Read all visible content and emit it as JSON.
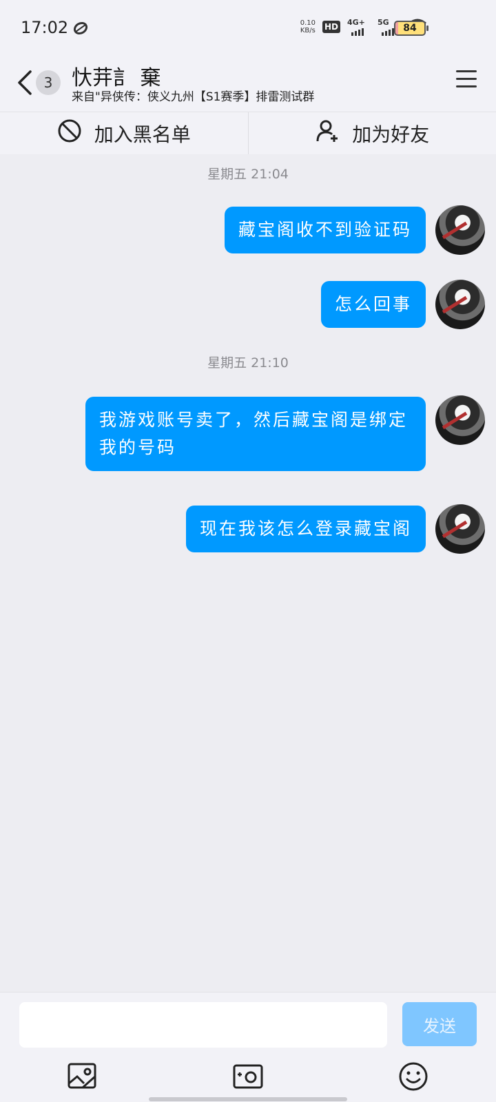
{
  "status_bar": {
    "time": "17:02",
    "net_speed_value": "0.10",
    "net_speed_unit": "KB/s",
    "hd_label": "HD",
    "net_4g": "4G+",
    "net_5g": "5G",
    "battery": "84"
  },
  "header": {
    "back_badge": "3",
    "title": "忕茾訁 棄",
    "subtitle": "来自\"异侠传：侠义九州【S1赛季】排雷测试群"
  },
  "actions": {
    "blacklist_label": "加入黑名单",
    "add_friend_label": "加为好友"
  },
  "messages": [
    {
      "type": "timestamp",
      "text": "星期五 21:04"
    },
    {
      "type": "sent",
      "text": "藏宝阁收不到验证码"
    },
    {
      "type": "sent",
      "text": "怎么回事"
    },
    {
      "type": "timestamp",
      "text": "星期五 21:10"
    },
    {
      "type": "sent",
      "text": "我游戏账号卖了，然后藏宝阁是绑定我的号码"
    },
    {
      "type": "sent",
      "text": "现在我该怎么登录藏宝阁"
    }
  ],
  "composer": {
    "input_value": "",
    "send_label": "发送"
  },
  "colors": {
    "bubble": "#0099ff",
    "send_disabled": "#7fc6ff",
    "background": "#ededf2"
  },
  "icons": [
    "image-icon",
    "camera-icon",
    "emoji-icon",
    "block-icon",
    "add-user-icon",
    "menu-icon",
    "back-chevron-icon"
  ]
}
